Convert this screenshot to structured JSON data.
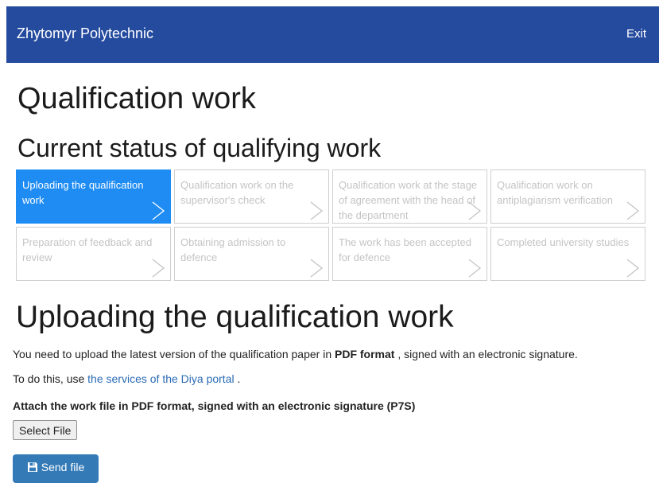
{
  "navbar": {
    "brand": "Zhytomyr Polytechnic",
    "exit_label": "Exit",
    "background": "#254b9f"
  },
  "page_title": "Qualification work",
  "status_title": "Current status of qualifying work",
  "steps": [
    {
      "label": "Uploading the qualification work",
      "active": true
    },
    {
      "label": "Qualification work on the supervisor's check",
      "active": false
    },
    {
      "label": "Qualification work at the stage of agreement with the head of the department",
      "active": false
    },
    {
      "label": "Qualification work on antiplagiarism verification",
      "active": false
    },
    {
      "label": "Preparation of feedback and review",
      "active": false
    },
    {
      "label": "Obtaining admission to defence",
      "active": false
    },
    {
      "label": "The work has been accepted for defence",
      "active": false
    },
    {
      "label": "Completed university studies",
      "active": false
    }
  ],
  "active_color": "#1e8cf2",
  "section": {
    "title": "Uploading the qualification work",
    "instruction_before": "You need to upload the latest version of the qualification paper in ",
    "instruction_bold": "PDF format",
    "instruction_after": " , signed with an electronic signature.",
    "diya_before": "To do this, use ",
    "diya_link": "the services of the Diya portal",
    "diya_after": " .",
    "attach_label": "Attach the work file in PDF format, signed with an electronic signature (P7S)",
    "select_file_label": "Select File",
    "send_label": "Send file",
    "send_icon": "floppy-disk-icon"
  }
}
